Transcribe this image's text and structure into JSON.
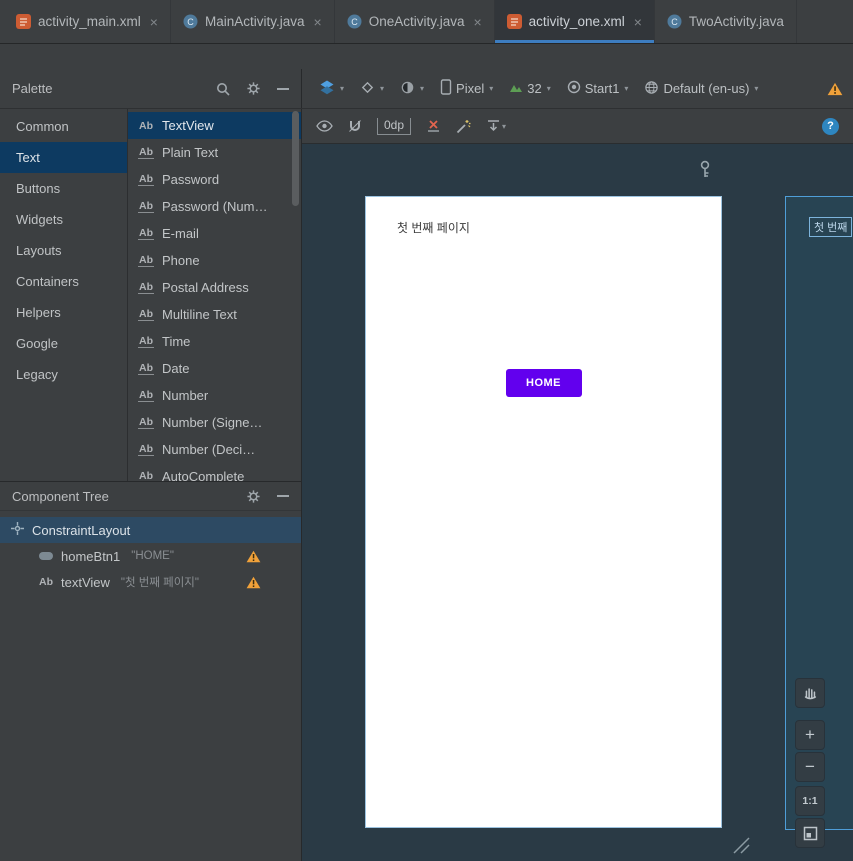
{
  "window": {
    "tabs": [
      {
        "label": "activity_main.xml",
        "icon": "xml-file",
        "selected": false
      },
      {
        "label": "MainActivity.java",
        "icon": "java-class",
        "selected": false
      },
      {
        "label": "OneActivity.java",
        "icon": "java-class",
        "selected": false
      },
      {
        "label": "activity_one.xml",
        "icon": "xml-file",
        "selected": true
      },
      {
        "label": "TwoActivity.java",
        "icon": "java-class",
        "selected": false
      }
    ]
  },
  "palette": {
    "title": "Palette",
    "categories": [
      "Common",
      "Text",
      "Buttons",
      "Widgets",
      "Layouts",
      "Containers",
      "Helpers",
      "Google",
      "Legacy"
    ],
    "selected_category": "Text",
    "item_icon": "Ab",
    "items": [
      "TextView",
      "Plain Text",
      "Password",
      "Password (Num…",
      "E-mail",
      "Phone",
      "Postal Address",
      "Multiline Text",
      "Time",
      "Date",
      "Number",
      "Number (Signe…",
      "Number (Deci…",
      "AutoComplete"
    ],
    "selected_item": "TextView"
  },
  "design_toolbar": {
    "device": "Pixel",
    "api": "32",
    "theme": "Start1",
    "locale": "Default (en-us)"
  },
  "canvas_toolbar": {
    "default_margin": "0dp",
    "help": "?"
  },
  "component_tree": {
    "title": "Component Tree",
    "nodes": [
      {
        "label": "ConstraintLayout",
        "detail": "",
        "selected": true,
        "warning": false
      },
      {
        "label": "homeBtn1",
        "detail": "\"HOME\"",
        "selected": false,
        "warning": true
      },
      {
        "label": "textView",
        "detail": "\"첫 번째 페이지\"",
        "selected": false,
        "warning": true
      }
    ]
  },
  "design_surface": {
    "screen_text": "첫 번째 페이지",
    "button_label": "HOME",
    "blueprint_label": "첫 번째",
    "zoom_reset": "1:1"
  },
  "icons": {
    "close": "×",
    "caret": "▾",
    "plus": "+",
    "minus": "−",
    "java_class": "C"
  },
  "colors": {
    "button_accent": "#6200EE",
    "warning": "#F0A13A",
    "selection_blue": "#0D3A61",
    "tab_underline": "#3D7DC0",
    "surface_background": "#2A3A45"
  }
}
